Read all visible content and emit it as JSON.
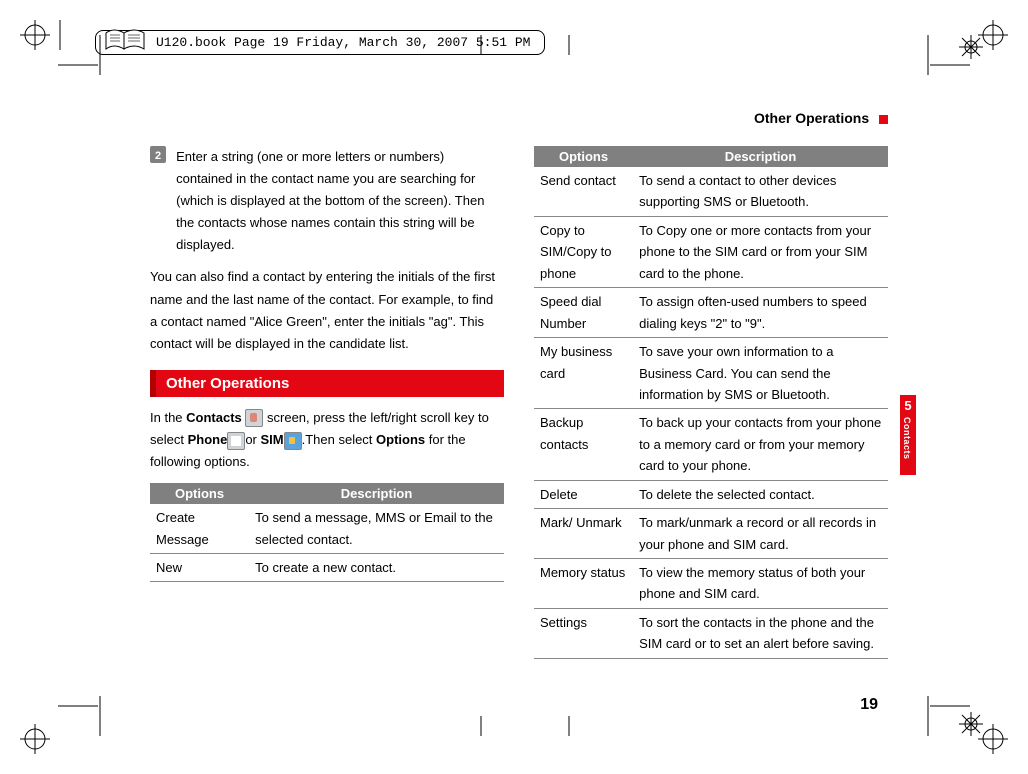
{
  "header_line": "U120.book  Page 19  Friday, March 30, 2007  5:51 PM",
  "running_head": "Other Operations",
  "step": {
    "num": "2",
    "text": "Enter a string (one or more letters or numbers) contained in the contact name you are searching for (which is displayed at the bottom of the screen). Then the contacts whose names contain this string will be displayed."
  },
  "intro_para": "You can also find a contact by entering the initials of the first name and the last name of the contact. For example, to find a contact named \"Alice Green\", enter the initials \"ag\". This contact will be displayed in the candidate list.",
  "section_title": "Other Operations",
  "contacts_para_1a": "In the ",
  "contacts_para_1b": "Contacts",
  "contacts_para_1c": " screen, press the left/right scroll key to select ",
  "contacts_para_1d": "Phone",
  "contacts_para_1e": "or ",
  "contacts_para_1f": "SIM",
  "contacts_para_1g": ".Then select ",
  "contacts_para_1h": "Options",
  "contacts_para_1i": " for the following options.",
  "left_table": {
    "headers": [
      "Options",
      "Description"
    ],
    "rows": [
      {
        "opt": "Create Message",
        "desc": "To send a message, MMS or Email to the selected contact."
      },
      {
        "opt": "New",
        "desc": "To create a new contact."
      }
    ]
  },
  "right_table": {
    "headers": [
      "Options",
      "Description"
    ],
    "rows": [
      {
        "opt": "Send contact",
        "desc": "To send a contact to other devices supporting SMS or Bluetooth."
      },
      {
        "opt": "Copy to SIM/Copy to phone",
        "desc": "To Copy one or more contacts from your phone to the SIM card or from your SIM card to the phone."
      },
      {
        "opt": "Speed dial Number",
        "desc": "To assign often-used numbers to speed dialing keys \"2\" to \"9\"."
      },
      {
        "opt": "My business card",
        "desc": "To save your own information to a Business Card. You can send the information by SMS or Bluetooth."
      },
      {
        "opt": "Backup contacts",
        "desc": "To back up your contacts from your phone to a memory card or from your memory card to your phone."
      },
      {
        "opt": "Delete",
        "desc": "To delete the selected contact."
      },
      {
        "opt": "Mark/ Unmark",
        "desc": "To mark/unmark a record or all records in your phone and SIM card."
      },
      {
        "opt": "Memory status",
        "desc": "To view the memory status of both your phone and SIM card."
      },
      {
        "opt": "Settings",
        "desc": "To sort the contacts in the phone and the SIM card or to set an alert before saving."
      }
    ]
  },
  "side_tab": {
    "num": "5",
    "label": "Contacts"
  },
  "page_number": "19"
}
